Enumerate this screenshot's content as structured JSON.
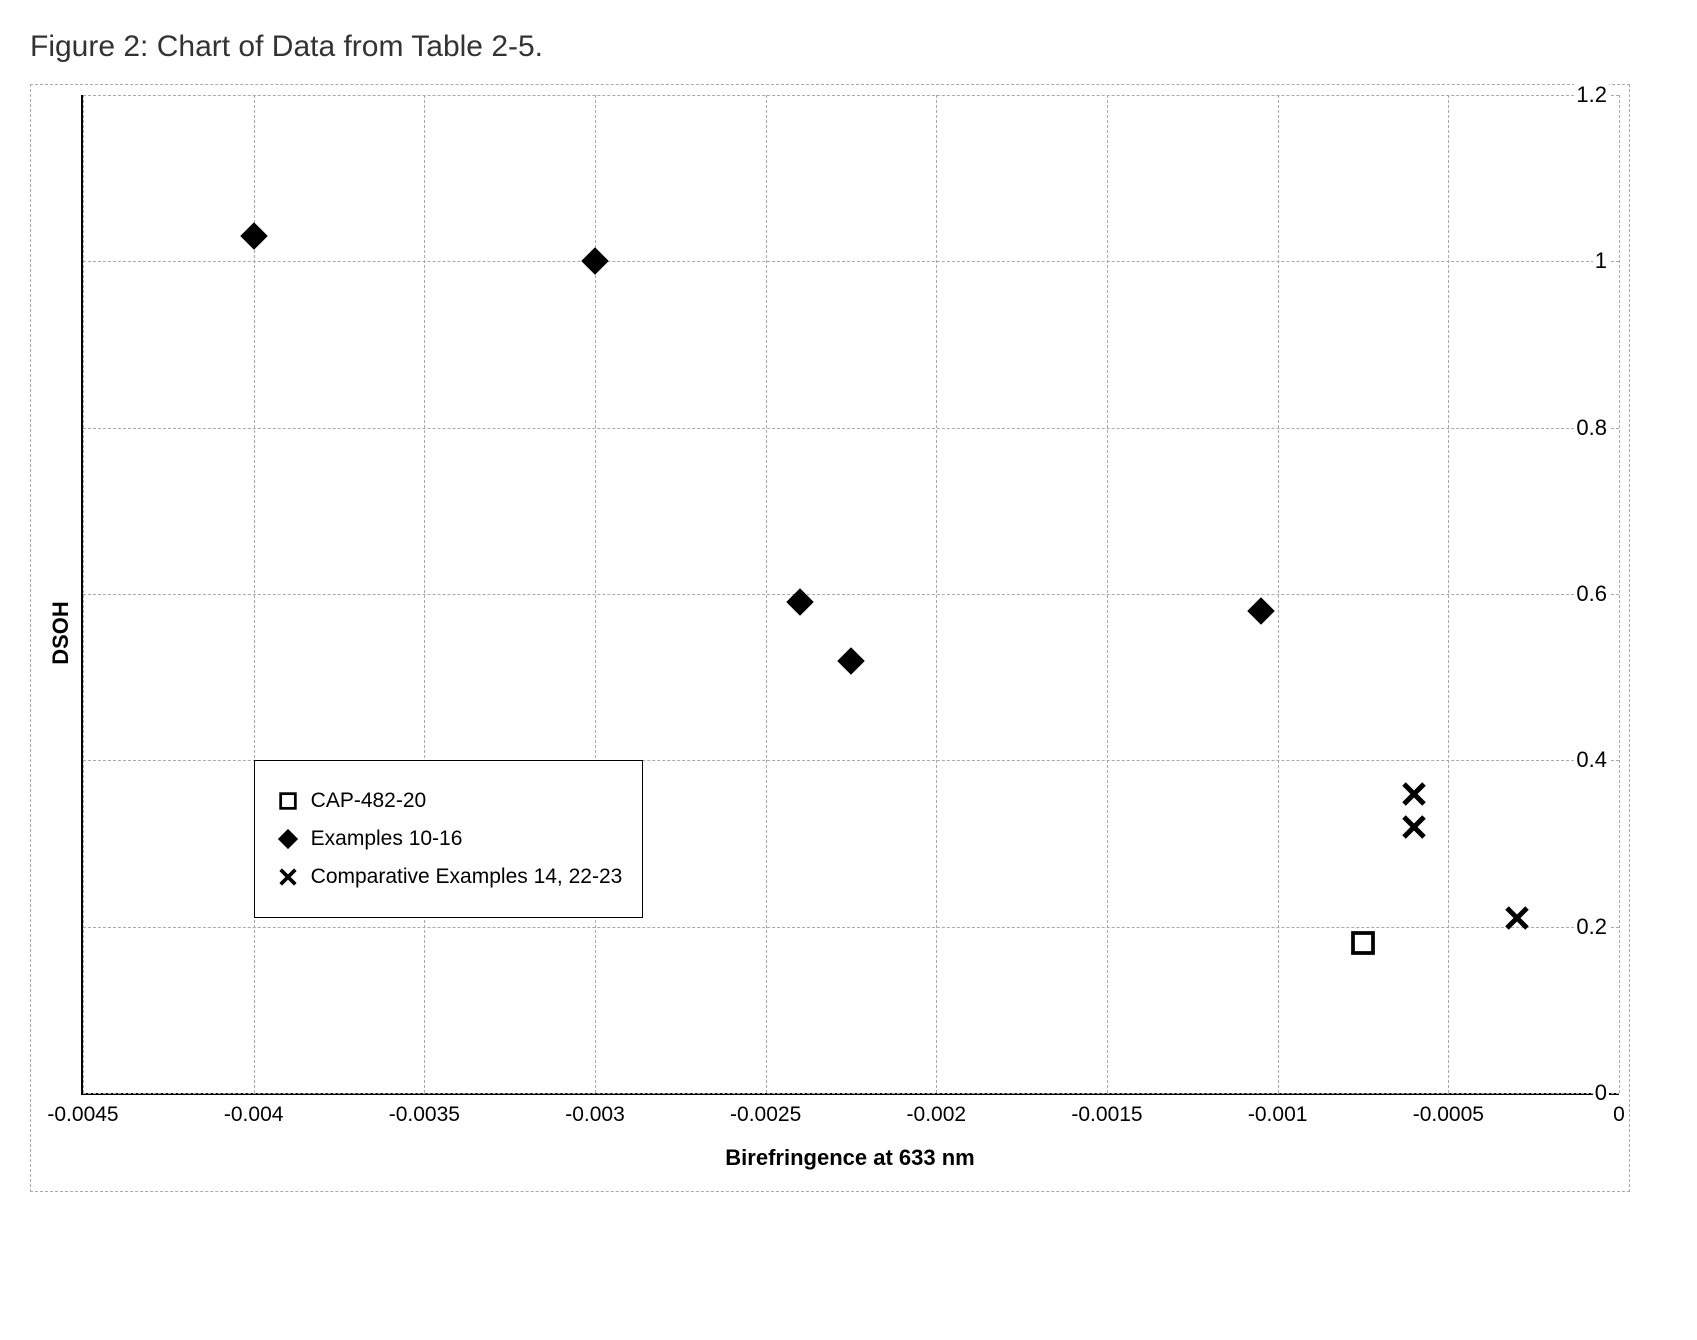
{
  "title": "Figure 2:  Chart of Data from Table 2-5.",
  "chart_data": {
    "type": "scatter",
    "xlabel": "Birefringence at 633 nm",
    "ylabel": "DSOH",
    "xlim": [
      -0.0045,
      0
    ],
    "ylim": [
      0,
      1.2
    ],
    "x_ticks": [
      -0.0045,
      -0.004,
      -0.0035,
      -0.003,
      -0.0025,
      -0.002,
      -0.0015,
      -0.001,
      -0.0005,
      0
    ],
    "x_tick_labels": [
      "-0.0045",
      "-0.004",
      "-0.0035",
      "-0.003",
      "-0.0025",
      "-0.002",
      "-0.0015",
      "-0.001",
      "-0.0005",
      "0"
    ],
    "y_ticks": [
      0,
      0.2,
      0.4,
      0.6,
      0.8,
      1,
      1.2
    ],
    "y_tick_labels": [
      "0",
      "0.2",
      "0.4",
      "0.6",
      "0.8",
      "1",
      "1.2"
    ],
    "series": [
      {
        "name": "CAP-482-20",
        "marker": "open-square",
        "points": [
          {
            "x": -0.00075,
            "y": 0.18
          }
        ]
      },
      {
        "name": "Examples 10-16",
        "marker": "filled-diamond",
        "points": [
          {
            "x": -0.004,
            "y": 1.03
          },
          {
            "x": -0.003,
            "y": 1.0
          },
          {
            "x": -0.0024,
            "y": 0.59
          },
          {
            "x": -0.00225,
            "y": 0.52
          },
          {
            "x": -0.00105,
            "y": 0.58
          }
        ]
      },
      {
        "name": "Comparative Examples 14, 22-23",
        "marker": "x",
        "points": [
          {
            "x": -0.0006,
            "y": 0.36
          },
          {
            "x": -0.0006,
            "y": 0.32
          },
          {
            "x": -0.0003,
            "y": 0.21
          }
        ]
      }
    ],
    "legend_position": {
      "x": -0.004,
      "y": 0.4
    }
  }
}
